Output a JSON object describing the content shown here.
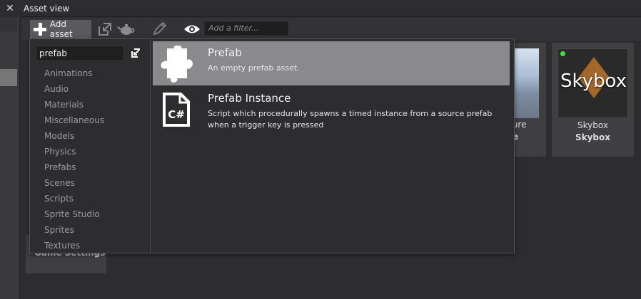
{
  "window": {
    "close_glyph": "✕",
    "title": "Asset view"
  },
  "toolbar": {
    "add_label": "Add asset",
    "filter_placeholder": "Add a filter...",
    "icons": [
      "plus-icon",
      "import-icon",
      "teapot-icon",
      "pencil-icon",
      "eye-icon"
    ]
  },
  "assets": {
    "texture": {
      "label": "xture",
      "type": "re"
    },
    "skybox": {
      "thumb_text": "Skybox",
      "label": "Skybox",
      "type": "Skybox",
      "status_color": "#3ee03a"
    },
    "game_settings": {
      "label": "Game Settings"
    }
  },
  "popup": {
    "search_value": "prefab",
    "categories": [
      "Animations",
      "Audio",
      "Materials",
      "Miscellaneous",
      "Models",
      "Physics",
      "Prefabs",
      "Scenes",
      "Scripts",
      "Sprite Studio",
      "Sprites",
      "Textures"
    ],
    "results": [
      {
        "title": "Prefab",
        "description": "An empty prefab asset.",
        "icon": "puzzle-icon",
        "selected": true
      },
      {
        "title": "Prefab Instance",
        "description": "Script which procedurally spawns a timed instance from a source prefab when a trigger key is pressed",
        "icon": "csharp-file-icon",
        "selected": false
      }
    ]
  }
}
